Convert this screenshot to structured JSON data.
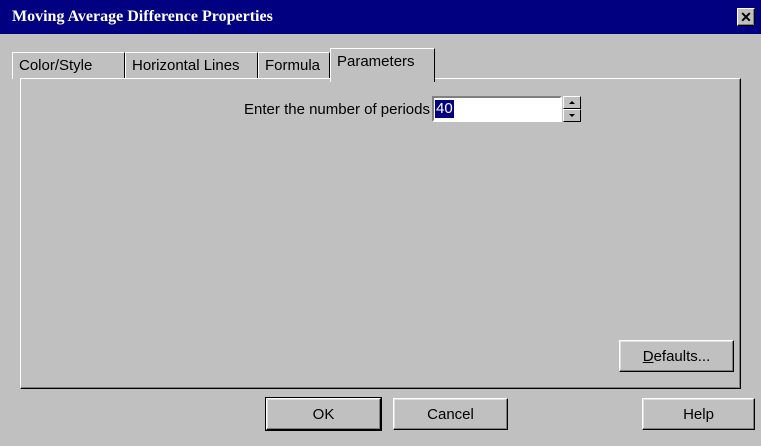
{
  "window": {
    "title": "Moving Average Difference Properties",
    "close_glyph": "✕"
  },
  "tabs": [
    {
      "label": "Color/Style",
      "active": false
    },
    {
      "label": "Horizontal Lines",
      "active": false
    },
    {
      "label": "Formula",
      "active": false
    },
    {
      "label": "Parameters",
      "active": true
    }
  ],
  "parameters": {
    "periods_label": "Enter the number of periods",
    "periods_value": "40"
  },
  "buttons": {
    "defaults_mnemonic": "D",
    "defaults_rest": "efaults...",
    "ok": "OK",
    "cancel": "Cancel",
    "help": "Help"
  },
  "colors": {
    "titlebar": "#000080",
    "face": "#c0c0c0",
    "selection": "#000080"
  }
}
